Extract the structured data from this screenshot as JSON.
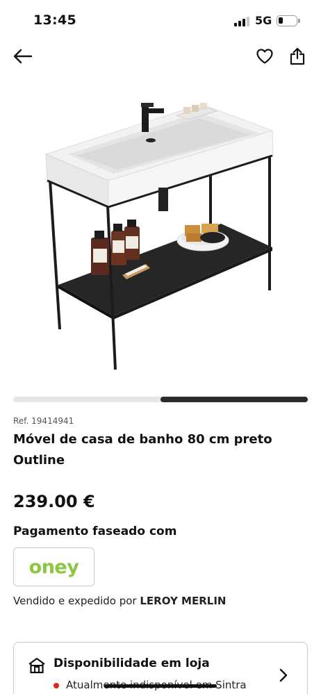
{
  "status_bar": {
    "time": "13:45",
    "network": "5G",
    "battery_level": 0.25
  },
  "nav": {
    "back_icon": "arrow-left-icon",
    "favorite_icon": "heart-icon",
    "share_icon": "share-icon"
  },
  "gallery": {
    "progress_start": 0.5,
    "progress_end": 1.0
  },
  "product": {
    "ref": "Ref. 19414941",
    "title": "Móvel de casa de banho 80 cm preto Outline",
    "price": "239.00 €"
  },
  "payment": {
    "installments_label": "Pagamento faseado com",
    "provider_logo": "oney",
    "provider_color": "#8dc63f"
  },
  "seller": {
    "prefix": "Vendido e expedido por ",
    "name": "LEROY MERLIN"
  },
  "availability": {
    "title": "Disponibilidade em loja",
    "status": "Atualmente indisponível em Sintra",
    "status_color": "#e1261c"
  }
}
